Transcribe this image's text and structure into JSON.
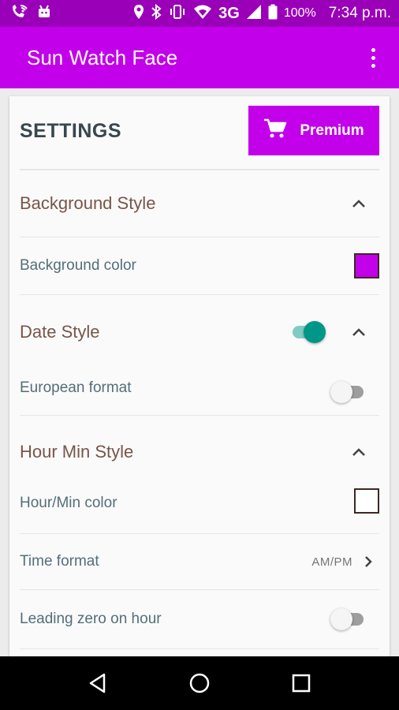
{
  "status_bar": {
    "network": "3G",
    "battery": "100%",
    "time": "7:34 p.m."
  },
  "app_bar": {
    "title": "Sun Watch Face"
  },
  "card": {
    "heading": "SETTINGS",
    "premium_label": "Premium"
  },
  "sections": {
    "background": {
      "title": "Background Style",
      "color_label": "Background color",
      "color_value": "#c200ea"
    },
    "date": {
      "title": "Date Style",
      "enabled": true,
      "european_label": "European format",
      "european_enabled": false
    },
    "hour_min": {
      "title": "Hour Min Style",
      "color_label": "Hour/Min color",
      "color_value": "#ffffff",
      "time_format_label": "Time format",
      "time_format_value": "AM/PM",
      "leading_zero_label": "Leading zero on hour",
      "leading_zero_enabled": false
    }
  },
  "colors": {
    "status_bar": "#9a00b8",
    "app_bar": "#c200ea",
    "accent_toggle": "#009688",
    "section_title": "#795548",
    "item_label": "#546e7a"
  }
}
